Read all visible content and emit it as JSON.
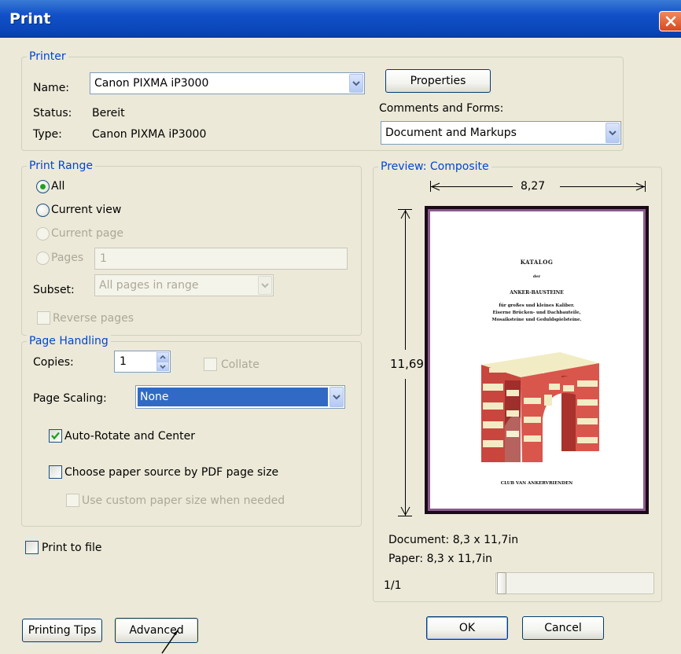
{
  "window": {
    "title": "Print"
  },
  "printer": {
    "legend": "Printer",
    "name_label": "Name:",
    "name_value": "Canon PIXMA iP3000",
    "status_label": "Status:",
    "status_value": "Bereit",
    "type_label": "Type:",
    "type_value": "Canon PIXMA iP3000",
    "properties_label": "Properties",
    "comments_label": "Comments and Forms:",
    "comments_value": "Document and Markups"
  },
  "print_range": {
    "legend": "Print Range",
    "all_label": "All",
    "current_view_label": "Current view",
    "current_page_label": "Current page",
    "pages_label": "Pages",
    "pages_value": "1",
    "subset_label": "Subset:",
    "subset_value": "All pages in range",
    "reverse_label": "Reverse pages",
    "selected": "all"
  },
  "page_handling": {
    "legend": "Page Handling",
    "copies_label": "Copies:",
    "copies_value": "1",
    "collate_label": "Collate",
    "scaling_label": "Page Scaling:",
    "scaling_value": "None",
    "auto_rotate_label": "Auto-Rotate and Center",
    "auto_rotate_checked": true,
    "paper_source_label": "Choose paper source by PDF page size",
    "paper_source_checked": false,
    "custom_paper_label": "Use custom paper size when needed"
  },
  "print_to_file_label": "Print to file",
  "preview": {
    "legend": "Preview: Composite",
    "width": "8,27",
    "height": "11,69",
    "document_info": "Document: 8,3 x 11,7in",
    "paper_info": "Paper: 8,3 x 11,7in",
    "page_counter": "1/1",
    "page": {
      "title": "KATALOG",
      "der": "der",
      "subtitle": "ANKER-BAUSTEINE",
      "description_1": "für großes und kleines Kaliber.",
      "description_2": "Eiserne Brücken- und Dachbauteile,",
      "description_3": "Mosaiksteine und Geduldspielsteine.",
      "footer": "CLUB VAN ANKERVRIENDEN"
    }
  },
  "buttons": {
    "printing_tips": "Printing Tips",
    "advanced": "Advanced",
    "ok": "OK",
    "cancel": "Cancel"
  },
  "colors": {
    "titlebar": "#0a46b8",
    "legend": "#0046D5",
    "selection": "#316AC5",
    "check_mark": "#21A121"
  }
}
